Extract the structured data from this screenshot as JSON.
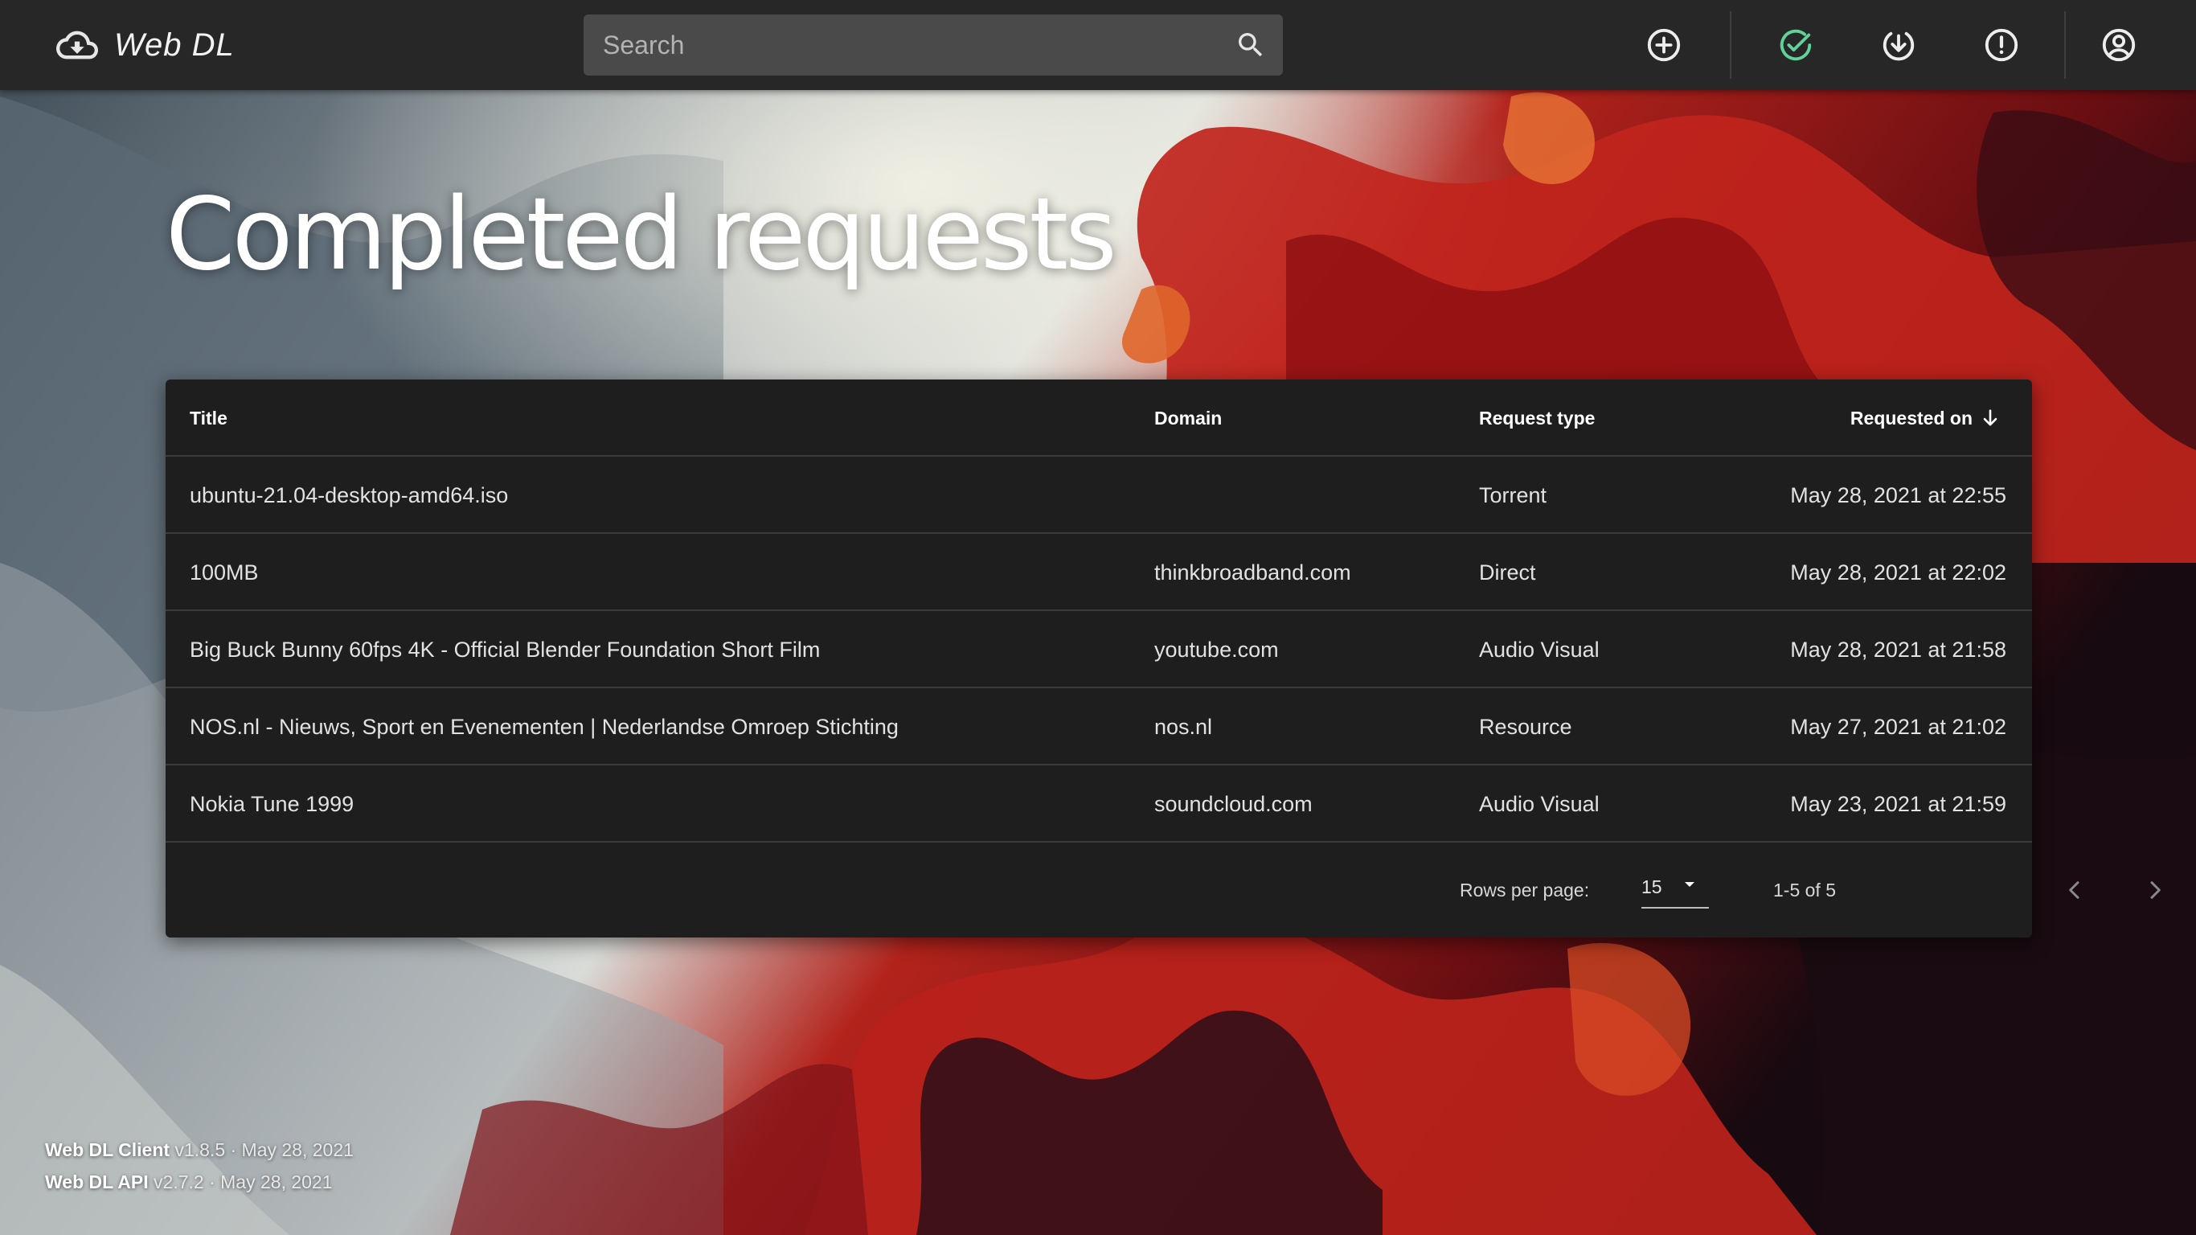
{
  "app": {
    "name": "Web DL",
    "logo_icon": "cloud-download-icon"
  },
  "search": {
    "placeholder": "Search",
    "value": "",
    "icon": "search-icon"
  },
  "nav": {
    "items": [
      {
        "name": "add-request",
        "icon": "plus-circle-icon",
        "active": false
      },
      {
        "name": "completed-requests",
        "icon": "check-circle-icon",
        "active": true,
        "color": "#5fd39a"
      },
      {
        "name": "downloads",
        "icon": "download-circle-icon",
        "active": false
      },
      {
        "name": "failed-requests",
        "icon": "alert-circle-icon",
        "active": false
      },
      {
        "name": "account",
        "icon": "account-circle-icon",
        "active": false
      }
    ]
  },
  "page": {
    "title": "Completed requests"
  },
  "table": {
    "columns": {
      "title": "Title",
      "domain": "Domain",
      "request_type": "Request type",
      "requested_on": "Requested on"
    },
    "sort": {
      "column": "requested_on",
      "direction": "descending",
      "icon": "arrow-down-icon"
    },
    "rows": [
      {
        "title": "ubuntu-21.04-desktop-amd64.iso",
        "domain": "",
        "request_type": "Torrent",
        "requested_on": "May 28, 2021 at 22:55"
      },
      {
        "title": "100MB",
        "domain": "thinkbroadband.com",
        "request_type": "Direct",
        "requested_on": "May 28, 2021 at 22:02"
      },
      {
        "title": "Big Buck Bunny 60fps 4K - Official Blender Foundation Short Film",
        "domain": "youtube.com",
        "request_type": "Audio Visual",
        "requested_on": "May 28, 2021 at 21:58"
      },
      {
        "title": "NOS.nl - Nieuws, Sport en Evenementen | Nederlandse Omroep Stichting",
        "domain": "nos.nl",
        "request_type": "Resource",
        "requested_on": "May 27, 2021 at 21:02"
      },
      {
        "title": "Nokia Tune 1999",
        "domain": "soundcloud.com",
        "request_type": "Audio Visual",
        "requested_on": "May 23, 2021 at 21:59"
      }
    ],
    "pagination": {
      "rows_per_page_label": "Rows per page:",
      "rows_per_page": "15",
      "range": "1-5 of 5",
      "prev_icon": "chevron-left-icon",
      "next_icon": "chevron-right-icon"
    }
  },
  "footer": {
    "client": {
      "name": "Web DL Client",
      "details": "v1.8.5 · May 28, 2021"
    },
    "api": {
      "name": "Web DL API",
      "details": "v2.7.2 · May 28, 2021"
    }
  },
  "colors": {
    "appbar": "#272727",
    "card": "#1e1e1e",
    "accent": "#5fd39a",
    "search_bg": "#4a4a4a"
  }
}
